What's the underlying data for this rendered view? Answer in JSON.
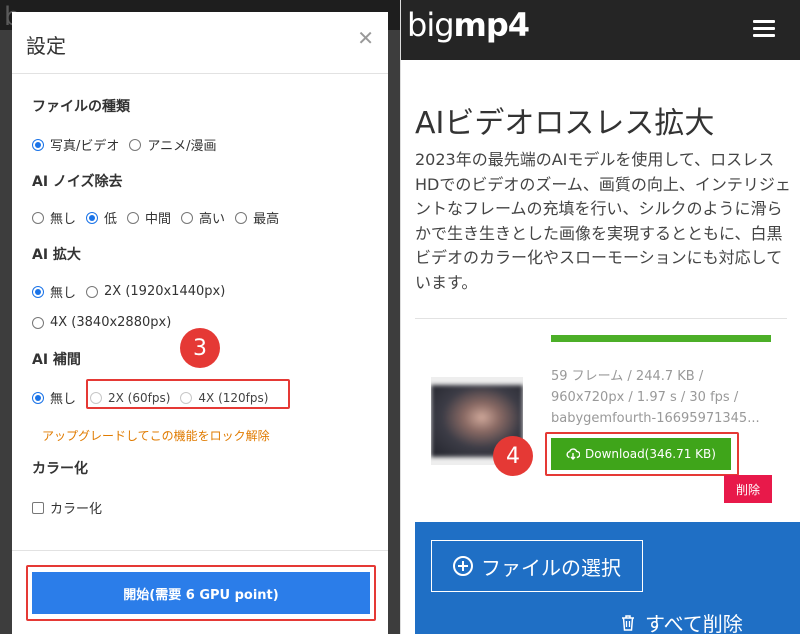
{
  "dialog": {
    "title": "設定",
    "close_glyph": "✕",
    "file_type": {
      "title": "ファイルの種類",
      "options": [
        "写真/ビデオ",
        "アニメ/漫画"
      ],
      "selected": "写真/ビデオ"
    },
    "noise": {
      "title": "AI ノイズ除去",
      "options": [
        "無し",
        "低",
        "中間",
        "高い",
        "最高"
      ],
      "selected": "低"
    },
    "upscale": {
      "title": "AI 拡大",
      "options": [
        "無し",
        "2X (1920x1440px)",
        "4X (3840x2880px)"
      ],
      "selected": "無し"
    },
    "interp": {
      "title": "AI 補間",
      "options": [
        "無し",
        "2X (60fps)",
        "4X (120fps)"
      ],
      "selected": "無し",
      "upgrade_note": "アップグレードしてこの機能をロック解除"
    },
    "colorize": {
      "title": "カラー化",
      "checkbox_label": "カラー化"
    },
    "start_label": "開始(需要 6 GPU point)"
  },
  "annotations": {
    "step3": "3",
    "step4": "4"
  },
  "header": {
    "logo_thin": "big",
    "logo_bold": "mp4"
  },
  "hero": {
    "title": "AIビデオロスレス拡大",
    "description": "2023年の最先端のAIモデルを使用して、ロスレスHDでのビデオのズーム、画質の向上、インテリジェントなフレームの充填を行い、シルクのように滑らかで生き生きとした画像を実現するとともに、白黒ビデオのカラー化やスローモーションにも対応しています。"
  },
  "file_item": {
    "progress": 1.0,
    "meta_line1": "59 フレーム / 244.7 KB /",
    "meta_line2": "960x720px / 1.97 s / 30 fps /",
    "meta_line3": "babygemfourth-16695971345...",
    "download_label": "Download(346.71 KB)",
    "delete_label": "削除"
  },
  "upload": {
    "select_label": "ファイルの選択",
    "clear_label": "すべて削除"
  },
  "colors": {
    "accent_blue": "#2b7de9",
    "download_green": "#3fa51a",
    "delete_red": "#e8194a",
    "annotation_red": "#e53935",
    "upgrade_orange": "#e07b00",
    "upload_blue": "#1f6fc5"
  }
}
